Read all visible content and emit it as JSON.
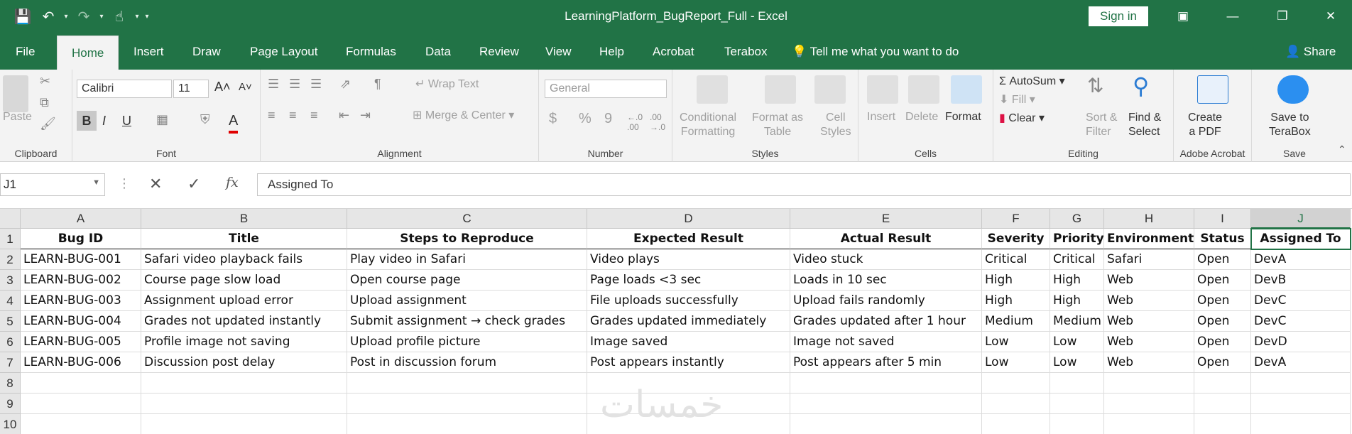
{
  "window": {
    "title": "LearningPlatform_BugReport_Full  -  Excel",
    "signin_label": "Sign in"
  },
  "tabs": [
    "File",
    "Home",
    "Insert",
    "Draw",
    "Page Layout",
    "Formulas",
    "Data",
    "Review",
    "View",
    "Help",
    "Acrobat",
    "Terabox"
  ],
  "tell_me": "Tell me what you want to do",
  "share_label": "Share",
  "ribbon": {
    "clipboard": {
      "paste": "Paste",
      "label": "Clipboard"
    },
    "font": {
      "name": "Calibri",
      "size": "11",
      "bold": "B",
      "italic": "I",
      "underline": "U",
      "label": "Font"
    },
    "alignment": {
      "wrap": "Wrap Text",
      "merge": "Merge & Center",
      "label": "Alignment"
    },
    "number": {
      "format": "General",
      "currency": "$",
      "percent": "%",
      "comma": "9",
      "label": "Number"
    },
    "styles": {
      "conditional": [
        "Conditional",
        "Formatting"
      ],
      "format_table": [
        "Format as",
        "Table"
      ],
      "cell_styles": [
        "Cell",
        "Styles"
      ],
      "label": "Styles"
    },
    "cells": {
      "insert": "Insert",
      "delete": "Delete",
      "format": "Format",
      "label": "Cells"
    },
    "editing": {
      "autosum": "AutoSum",
      "fill": "Fill",
      "clear": "Clear",
      "sort": [
        "Sort &",
        "Filter"
      ],
      "find": [
        "Find &",
        "Select"
      ],
      "label": "Editing"
    },
    "acrobat": {
      "create": [
        "Create",
        "a PDF"
      ],
      "label": "Adobe Acrobat"
    },
    "save": {
      "save_to": [
        "Save to",
        "TeraBox"
      ],
      "label": "Save"
    }
  },
  "formula_bar": {
    "name_box": "J1",
    "content": "Assigned To",
    "fx": "fx"
  },
  "sheet": {
    "columns": [
      "A",
      "B",
      "C",
      "D",
      "E",
      "F",
      "G",
      "H",
      "I",
      "J"
    ],
    "selected_column": "J",
    "rows": [
      "1",
      "2",
      "3",
      "4",
      "5",
      "6",
      "7",
      "8",
      "9",
      "10"
    ],
    "header": [
      "Bug ID",
      "Title",
      "Steps to Reproduce",
      "Expected Result",
      "Actual Result",
      "Severity",
      "Priority",
      "Environment",
      "Status",
      "Assigned To"
    ],
    "data": [
      [
        "LEARN-BUG-001",
        "Safari video playback fails",
        "Play video in Safari",
        "Video plays",
        "Video stuck",
        "Critical",
        "Critical",
        "Safari",
        "Open",
        "DevA"
      ],
      [
        "LEARN-BUG-002",
        "Course page slow load",
        "Open course page",
        "Page loads <3 sec",
        "Loads in 10 sec",
        "High",
        "High",
        "Web",
        "Open",
        "DevB"
      ],
      [
        "LEARN-BUG-003",
        "Assignment upload error",
        "Upload assignment",
        "File uploads successfully",
        "Upload fails randomly",
        "High",
        "High",
        "Web",
        "Open",
        "DevC"
      ],
      [
        "LEARN-BUG-004",
        "Grades not updated instantly",
        "Submit assignment → check grades",
        "Grades updated immediately",
        "Grades updated after 1 hour",
        "Medium",
        "Medium",
        "Web",
        "Open",
        "DevC"
      ],
      [
        "LEARN-BUG-005",
        "Profile image not saving",
        "Upload profile picture",
        "Image saved",
        "Image not saved",
        "Low",
        "Low",
        "Web",
        "Open",
        "DevD"
      ],
      [
        "LEARN-BUG-006",
        "Discussion post delay",
        "Post in discussion forum",
        "Post appears instantly",
        "Post appears after 5 min",
        "Low",
        "Low",
        "Web",
        "Open",
        "DevA"
      ]
    ]
  },
  "watermark": "خمسات"
}
